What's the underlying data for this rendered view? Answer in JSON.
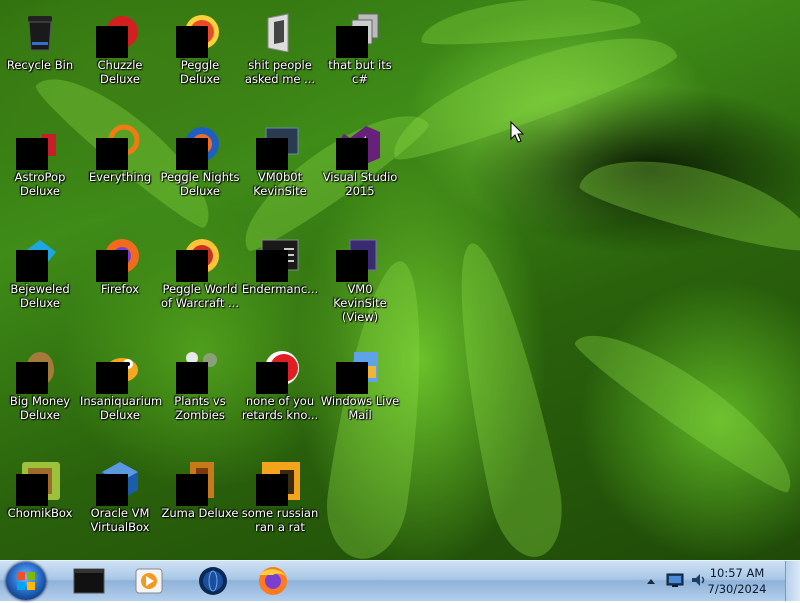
{
  "desktop": {
    "icons": [
      {
        "label": "Recycle Bin",
        "icon": "recycle-bin-icon"
      },
      {
        "label": "Chuzzle Deluxe",
        "icon": "chuzzle-icon"
      },
      {
        "label": "Peggle Deluxe",
        "icon": "peggle-icon"
      },
      {
        "label": "shit people asked me ...",
        "icon": "folder-icon"
      },
      {
        "label": "that but its c#",
        "icon": "folder-stack-icon"
      },
      {
        "label": "AstroPop Deluxe",
        "icon": "astropop-icon"
      },
      {
        "label": "Everything",
        "icon": "everything-search-icon"
      },
      {
        "label": "Peggle Nights Deluxe",
        "icon": "peggle-nights-icon"
      },
      {
        "label": "VM0b0t KevinSite",
        "icon": "vm-shortcut-icon"
      },
      {
        "label": "Visual Studio 2015",
        "icon": "visual-studio-icon"
      },
      {
        "label": "Bejeweled Deluxe",
        "icon": "bejeweled-icon"
      },
      {
        "label": "Firefox",
        "icon": "firefox-icon"
      },
      {
        "label": "Peggle World of Warcraft ...",
        "icon": "peggle-wow-icon"
      },
      {
        "label": "Endermanc...",
        "icon": "terminal-window-icon"
      },
      {
        "label": "VM0 KevinSite (View)",
        "icon": "vm-view-icon"
      },
      {
        "label": "Big Money Deluxe",
        "icon": "big-money-icon"
      },
      {
        "label": "Insaniquarium Deluxe",
        "icon": "insaniquarium-icon"
      },
      {
        "label": "Plants vs Zombies",
        "icon": "plants-vs-zombies-icon"
      },
      {
        "label": "none of you retards kno...",
        "icon": "chuzzle-red-icon"
      },
      {
        "label": "Windows Live Mail",
        "icon": "windows-live-mail-icon"
      },
      {
        "label": "ChomikBox",
        "icon": "chomikbox-icon"
      },
      {
        "label": "Oracle VM VirtualBox",
        "icon": "virtualbox-icon"
      },
      {
        "label": "Zuma Deluxe",
        "icon": "zuma-icon"
      },
      {
        "label": "some russian ran a rat",
        "icon": "shortcut-app-icon"
      }
    ]
  },
  "taskbar": {
    "pinned": [
      {
        "name": "command-prompt-icon"
      },
      {
        "name": "media-player-icon"
      },
      {
        "name": "globe-icon"
      },
      {
        "name": "firefox-icon"
      }
    ],
    "tray": {
      "time": "10:57 AM",
      "date": "7/30/2024"
    }
  },
  "colors": {
    "taskbar": "#a9c7e6",
    "label_text": "#ffffff",
    "censor": "#000000"
  }
}
